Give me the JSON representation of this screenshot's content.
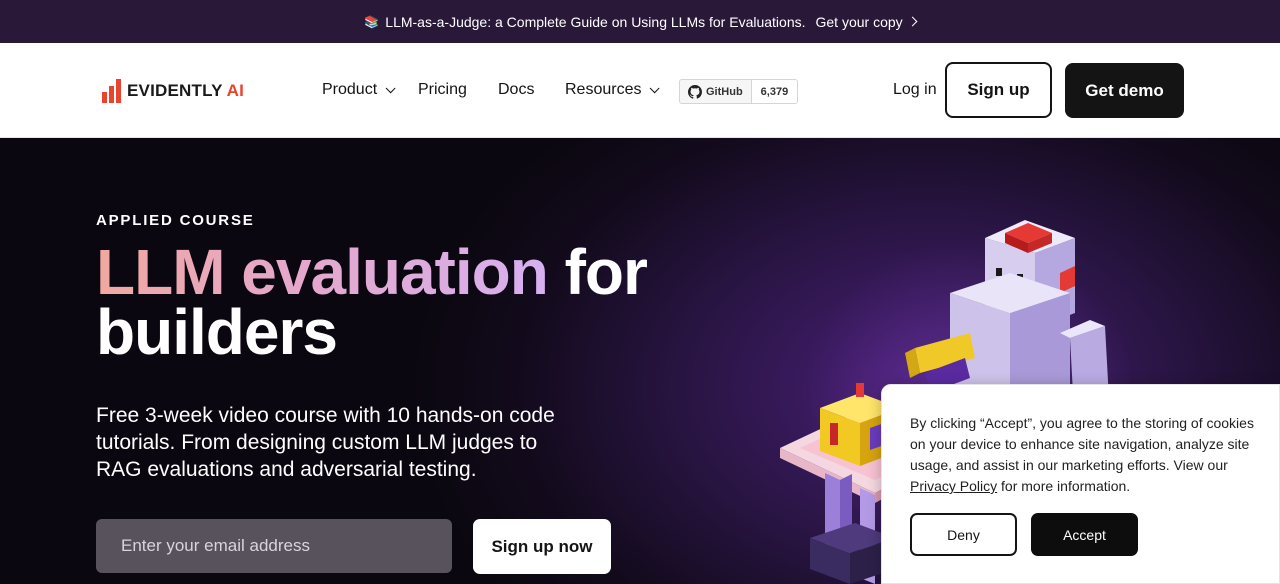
{
  "announcement": {
    "text": "LLM-as-a-Judge: a Complete Guide on Using LLMs for Evaluations.",
    "cta": "Get your copy",
    "icon": "book-icon"
  },
  "nav": {
    "logo_main": "EVIDENTLY",
    "logo_accent": "AI",
    "items": [
      {
        "label": "Product",
        "dropdown": true
      },
      {
        "label": "Pricing",
        "dropdown": false
      },
      {
        "label": "Docs",
        "dropdown": false
      },
      {
        "label": "Resources",
        "dropdown": true
      }
    ],
    "github": {
      "label": "GitHub",
      "count": "6,379"
    },
    "login": "Log in",
    "signup": "Sign up",
    "demo": "Get demo"
  },
  "hero": {
    "eyebrow": "APPLIED COURSE",
    "title_gradient": "LLM evaluation",
    "title_rest": "for",
    "title_line2": "builders",
    "subtitle": "Free 3-week video course with 10 hands-on code tutorials. From designing custom LLM judges to RAG evaluations and adversarial testing.",
    "email_placeholder": "Enter your email address",
    "cta": "Sign up now"
  },
  "cookie": {
    "text_before": "By clicking “Accept”, you agree to the storing of cookies on your device to enhance site navigation, analyze site usage, and assist in our marketing efforts. View our",
    "link": "Privacy Policy",
    "text_after": "for more information.",
    "deny": "Deny",
    "accept": "Accept"
  },
  "colors": {
    "brand_red": "#e8442e",
    "announce_bg": "#2a1839",
    "hero_purple": "#4a1f78",
    "button_dark": "#141414"
  }
}
